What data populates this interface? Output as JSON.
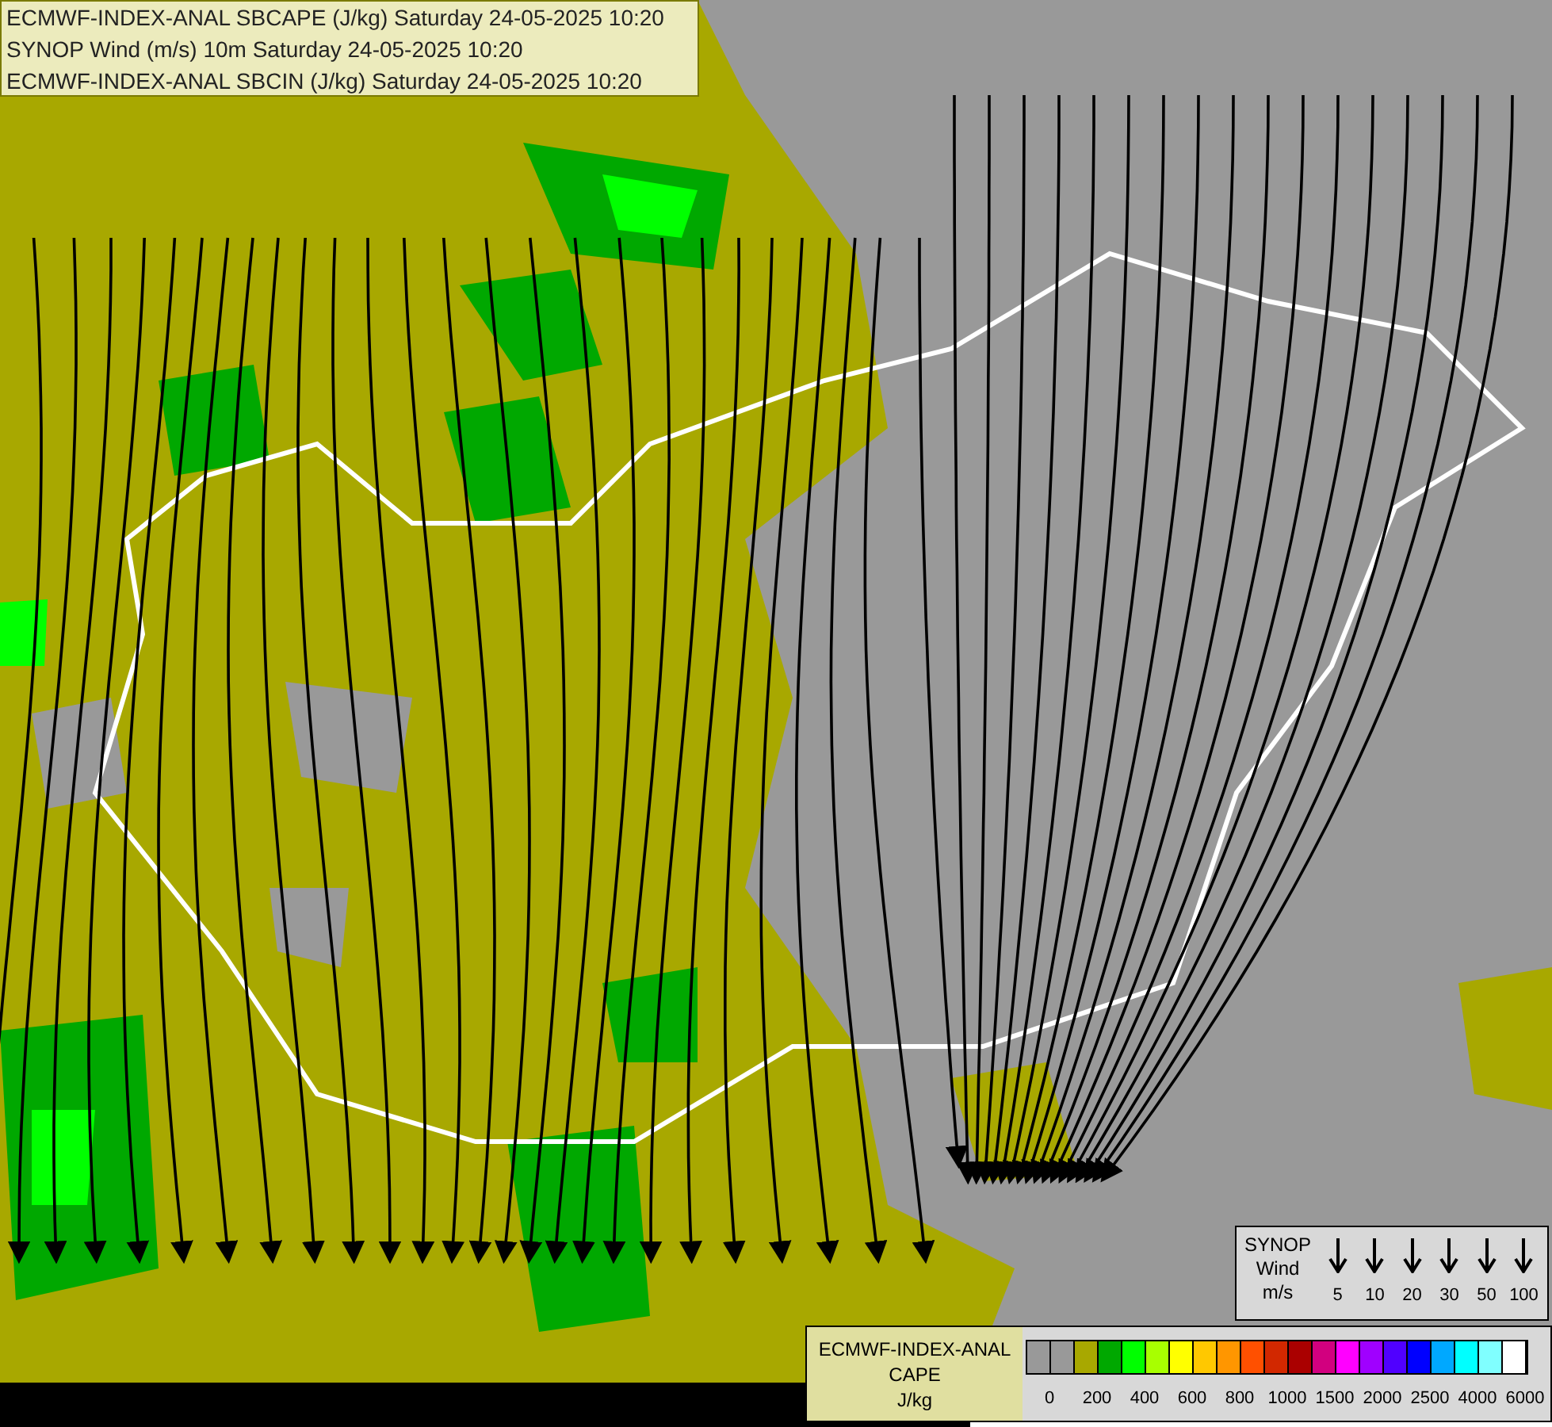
{
  "header": {
    "lines": [
      "ECMWF-INDEX-ANAL SBCAPE (J/kg) Saturday 24-05-2025 10:20",
      "SYNOP Wind (m/s) 10m Saturday 24-05-2025 10:20",
      "ECMWF-INDEX-ANAL SBCIN (J/kg) Saturday 24-05-2025 10:20"
    ]
  },
  "wind_legend": {
    "title_lines": [
      "SYNOP",
      "Wind",
      "m/s"
    ],
    "speeds": [
      "5",
      "10",
      "20",
      "30",
      "50",
      "100"
    ]
  },
  "cape_legend": {
    "title_lines": [
      "ECMWF-INDEX-ANAL",
      "CAPE",
      "J/kg"
    ],
    "swatches": [
      {
        "color": "#999999"
      },
      {
        "color": "#999999"
      },
      {
        "color": "#a8a800"
      },
      {
        "color": "#00a800"
      },
      {
        "color": "#00ff00"
      },
      {
        "color": "#a8ff00"
      },
      {
        "color": "#ffff00"
      },
      {
        "color": "#ffc800"
      },
      {
        "color": "#ff9600"
      },
      {
        "color": "#ff5000"
      },
      {
        "color": "#d22800"
      },
      {
        "color": "#aa0000"
      },
      {
        "color": "#d2007f"
      },
      {
        "color": "#ff00ff"
      },
      {
        "color": "#a000ff"
      },
      {
        "color": "#5000ff"
      },
      {
        "color": "#0000ff"
      },
      {
        "color": "#00a8ff"
      },
      {
        "color": "#00ffff"
      },
      {
        "color": "#80ffff"
      },
      {
        "color": "#ffffff"
      }
    ],
    "ticks": [
      "0",
      "200",
      "400",
      "600",
      "800",
      "1000",
      "1500",
      "2000",
      "2500",
      "4000",
      "6000"
    ]
  }
}
